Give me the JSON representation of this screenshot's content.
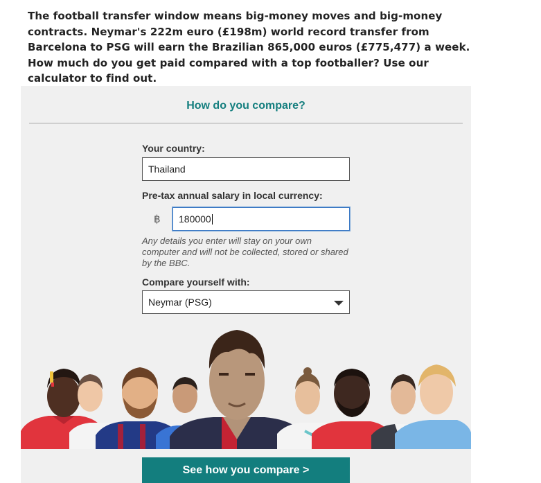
{
  "intro_text": "The football transfer window means big-money moves and big-money contracts. Neymar's 222m euro (£198m) world record transfer from Barcelona to PSG will earn the Brazilian 865,000 euros (£775,477) a week. How much do you get paid compared with a top footballer? Use our calculator to find out.",
  "calculator": {
    "title": "How do you compare?",
    "country_label": "Your country:",
    "country_value": "Thailand",
    "salary_label": "Pre-tax annual salary in local currency:",
    "currency_symbol": "฿",
    "salary_value": "180000",
    "disclaimer": "Any details you enter will stay on your own computer and will not be collected, stored or shared by the BBC.",
    "compare_label": "Compare yourself with:",
    "compare_value": "Neymar (PSG)",
    "submit_label": "See how you compare >"
  },
  "colors": {
    "accent": "#137e7e",
    "panel_bg": "#f0f0f0",
    "focus_border": "#3a78c4"
  },
  "icons": {
    "dropdown": "caret-down-icon"
  }
}
